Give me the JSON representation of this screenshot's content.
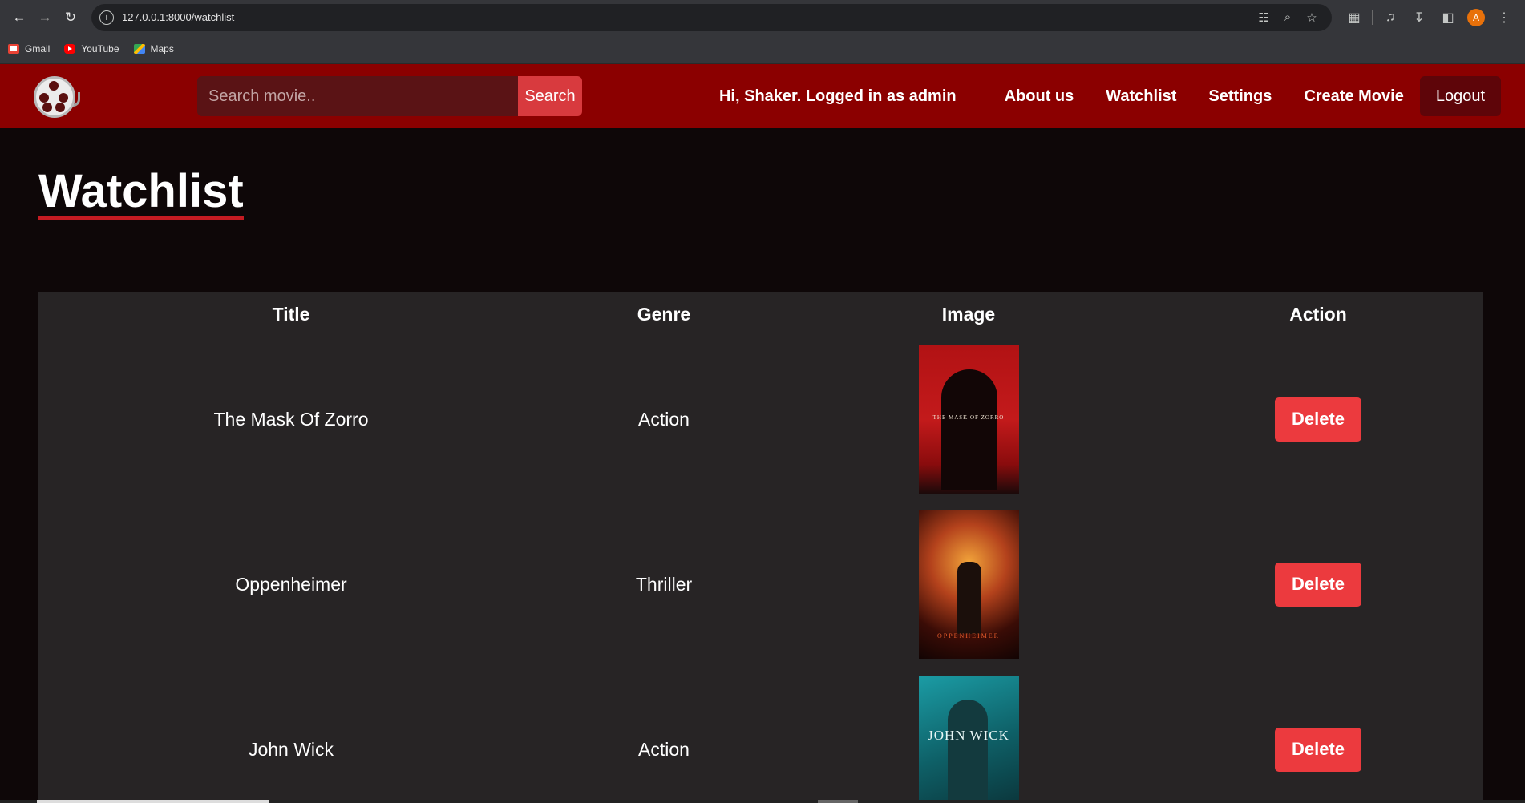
{
  "browser": {
    "url": "127.0.0.1:8000/watchlist",
    "profile_initial": "A",
    "bookmarks": [
      {
        "label": "Gmail",
        "icon": "gmail-icon"
      },
      {
        "label": "YouTube",
        "icon": "youtube-icon"
      },
      {
        "label": "Maps",
        "icon": "maps-icon"
      }
    ]
  },
  "header": {
    "search_placeholder": "Search movie..",
    "search_button": "Search",
    "greeting": "Hi, Shaker. Logged in as admin",
    "nav": [
      "About us",
      "Watchlist",
      "Settings",
      "Create Movie"
    ],
    "logout": "Logout"
  },
  "page": {
    "title": "Watchlist"
  },
  "table": {
    "headers": [
      "Title",
      "Genre",
      "Image",
      "Action"
    ],
    "rows": [
      {
        "title": "The Mask Of Zorro",
        "genre": "Action",
        "poster_text": "THE MASK OF ZORRO",
        "action": "Delete"
      },
      {
        "title": "Oppenheimer",
        "genre": "Thriller",
        "poster_text": "OPPENHEIMER",
        "action": "Delete"
      },
      {
        "title": "John Wick",
        "genre": "Action",
        "poster_text": "JOHN WICK",
        "action": "Delete"
      }
    ]
  },
  "colors": {
    "header_bg": "#8b0000",
    "page_bg": "#0e0708",
    "table_bg": "#272425",
    "delete_button": "#ec3a3e",
    "title_underline": "#c51b22"
  }
}
